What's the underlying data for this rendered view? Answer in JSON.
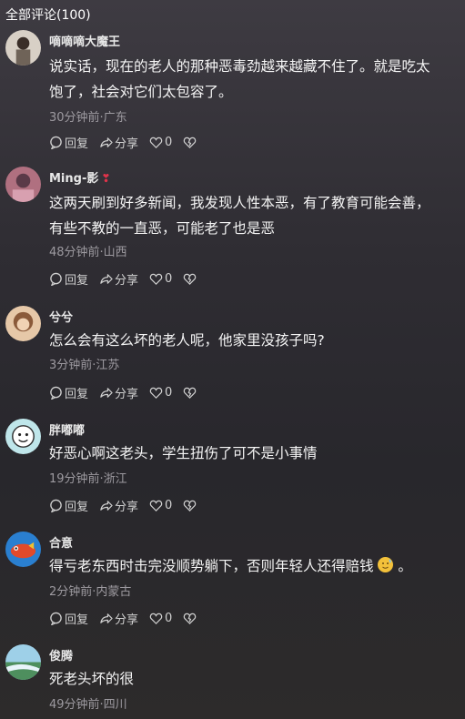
{
  "header": {
    "title": "全部评论(100)"
  },
  "labels": {
    "reply": "回复",
    "share": "分享"
  },
  "comments": [
    {
      "user": "嘀嘀嘀大魔王",
      "lines": [
        "说实话，现在的老人的那种恶毒劲越来越藏不住了。就是吃太",
        "饱了，社会对它们太包容了。"
      ],
      "meta": "30分钟前·广东",
      "likes": "0"
    },
    {
      "user": "Ming-影",
      "badge": "❣",
      "lines": [
        "这两天刷到好多新闻，我发现人性本恶，有了教育可能会善，",
        "有些不教的一直恶，可能老了也是恶"
      ],
      "meta": "48分钟前·山西",
      "likes": "0"
    },
    {
      "user": "兮兮",
      "lines": [
        "怎么会有这么坏的老人呢，他家里没孩子吗?"
      ],
      "meta": "3分钟前·江苏",
      "likes": "0"
    },
    {
      "user": "胖嘟嘟",
      "lines": [
        "好恶心啊这老头，学生扭伤了可不是小事情"
      ],
      "meta": "19分钟前·浙江",
      "likes": "0"
    },
    {
      "user": "合意",
      "lines": [
        "得亏老东西时击完没顺势躺下，否则年轻人还得赔钱",
        "。"
      ],
      "meta": "2分钟前·内蒙古",
      "likes": "0",
      "emoji": "sweat-smile-emoji"
    },
    {
      "user": "俊腾",
      "lines": [
        "死老头坏的很"
      ],
      "meta": "49分钟前·四川"
    }
  ],
  "avatars": [
    "#8a7f73",
    "#a0606a",
    "#c4a083",
    "#5fa4b0",
    "#2a7fd0",
    "#5c9a7a"
  ]
}
